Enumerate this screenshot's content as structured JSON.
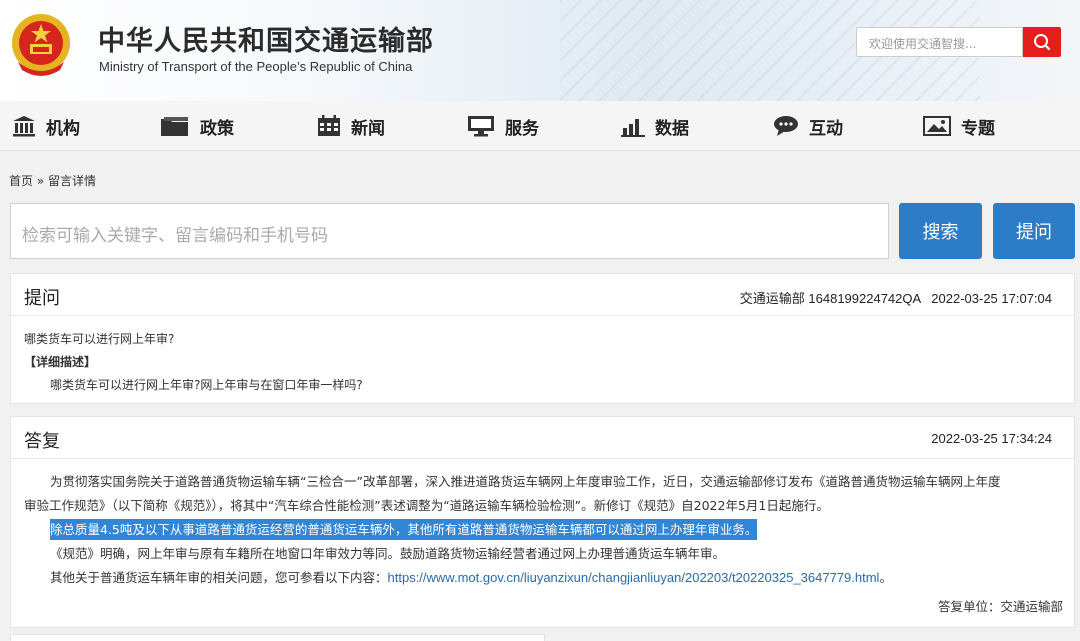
{
  "header": {
    "title_cn": "中华人民共和国交通运输部",
    "title_en": "Ministry of Transport of the People’s Republic of China",
    "search_placeholder": "欢迎使用交通智搜..."
  },
  "nav": [
    {
      "label": "机构",
      "icon": "institution-icon"
    },
    {
      "label": "政策",
      "icon": "folder-icon"
    },
    {
      "label": "新闻",
      "icon": "calendar-icon"
    },
    {
      "label": "服务",
      "icon": "monitor-icon"
    },
    {
      "label": "数据",
      "icon": "bar-chart-icon"
    },
    {
      "label": "互动",
      "icon": "chat-icon"
    },
    {
      "label": "专题",
      "icon": "picture-icon"
    }
  ],
  "breadcrumb": "首页 » 留言详情",
  "query": {
    "placeholder": "检索可输入关键字、留言编码和手机号码",
    "search_label": "搜索",
    "ask_label": "提问"
  },
  "question": {
    "heading": "提问",
    "meta": "交通运输部 1648199224742QA   2022-03-25 17:07:04",
    "title": "哪类货车可以进行网上年审?",
    "detail_label": "【详细描述】",
    "detail": "哪类货车可以进行网上年审?网上年审与在窗口年审一样吗?"
  },
  "answer": {
    "heading": "答复",
    "time": "2022-03-25 17:34:24",
    "p1_line1": "为贯彻落实国务院关于道路普通货物运输车辆“三检合一”改革部署，深入推进道路货运车辆网上年度审验工作，近日，交通运输部修订发布《道路普通货物运输车辆网上年度",
    "p1_line2": "审验工作规范》（以下简称《规范》），将其中“汽车综合性能检测”表述调整为“道路运输车辆检验检测”。新修订《规范》自2022年5月1日起施行。",
    "p2_highlight": "除总质量4.5吨及以下从事道路普通货运经营的普通货运车辆外，其他所有道路普通货物运输车辆都可以通过网上办理年审业务。",
    "p3": "《规范》明确，网上年审与原有车籍所在地窗口年审效力等同。鼓励道路货物运输经营者通过网上办理普通货运车辆年审。",
    "p4_prefix": "其他关于普通货运车辆年审的相关问题，您可参看以下内容：",
    "p4_link": "https://www.mot.gov.cn/liuyanzixun/changjianliuyan/202203/t20220325_3647779.html",
    "p4_suffix": "。",
    "unit": "答复单位：交通运输部"
  },
  "colors": {
    "accent_blue": "#2c7cc7",
    "search_red": "#e41d1d",
    "highlight": "#3385d6"
  }
}
